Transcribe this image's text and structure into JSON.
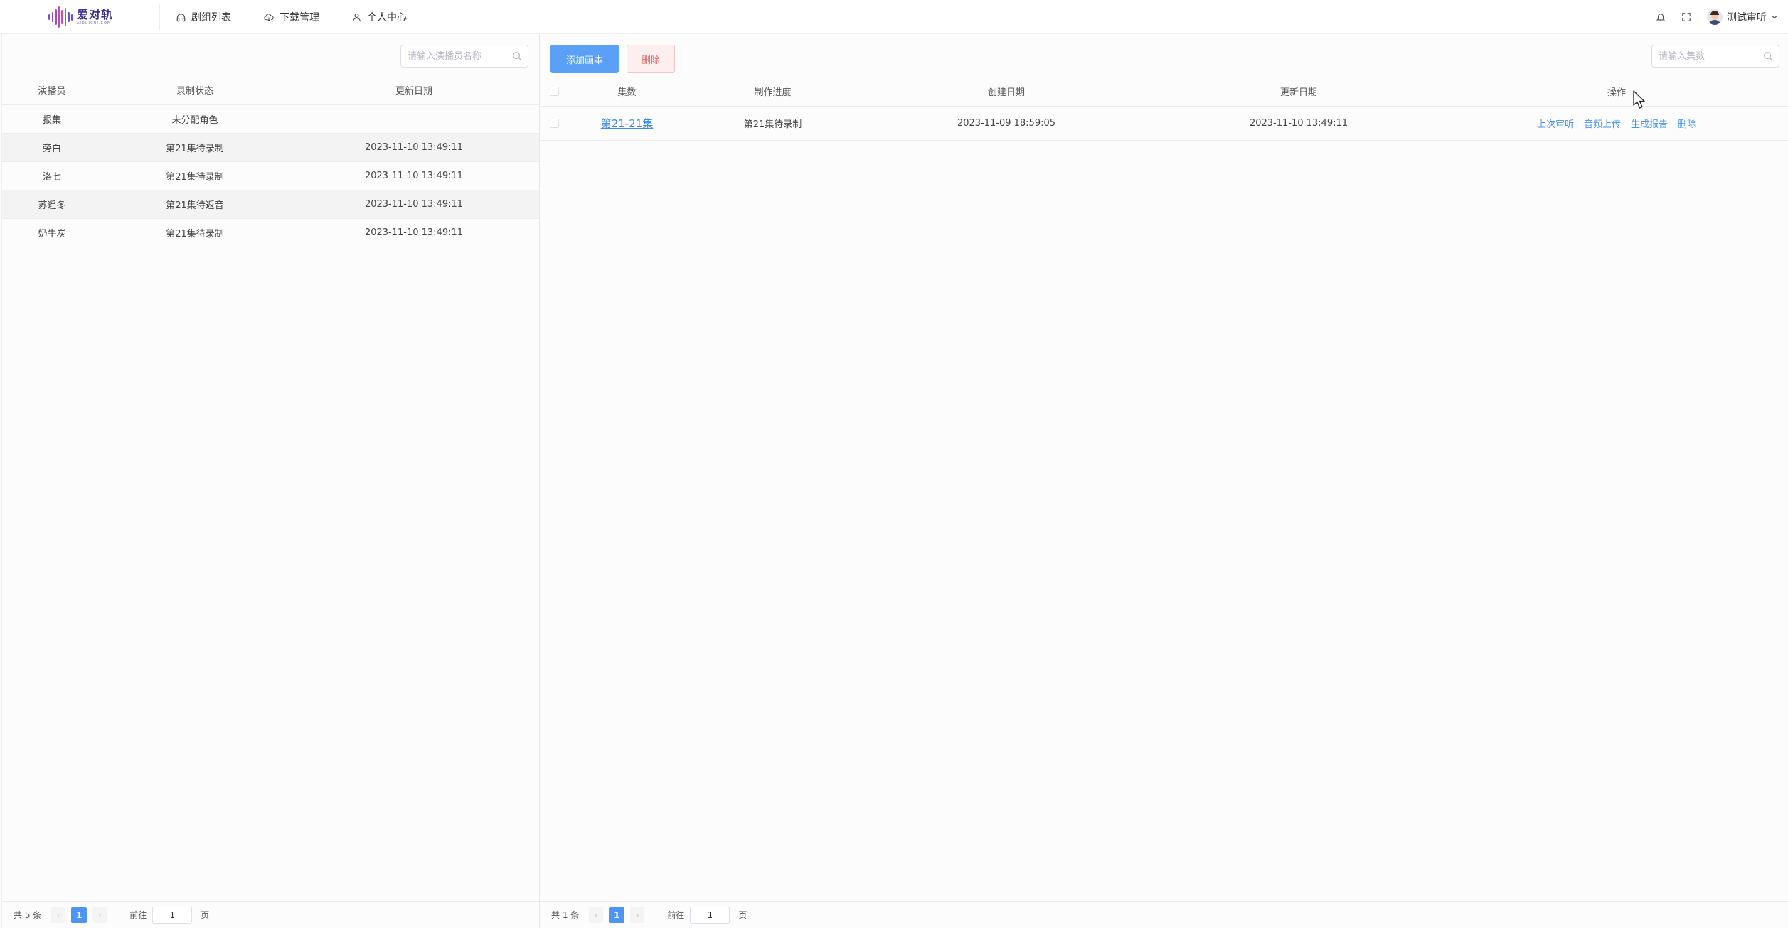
{
  "header": {
    "logo_name": "爱对轨",
    "logo_sub": "AIDUIGUI.COM",
    "nav": [
      {
        "label": "剧组列表",
        "icon": "headphones-icon"
      },
      {
        "label": "下载管理",
        "icon": "cloud-download-icon"
      },
      {
        "label": "个人中心",
        "icon": "user-icon"
      }
    ],
    "user_name": "测试审听"
  },
  "left_panel": {
    "search_placeholder": "请输入演播员名称",
    "columns": [
      "演播员",
      "录制状态",
      "更新日期"
    ],
    "rows": [
      {
        "name": "报集",
        "status": "未分配角色",
        "date": ""
      },
      {
        "name": "旁白",
        "status": "第21集待录制",
        "date": "2023-11-10 13:49:11"
      },
      {
        "name": "洛七",
        "status": "第21集待录制",
        "date": "2023-11-10 13:49:11"
      },
      {
        "name": "苏遥冬",
        "status": "第21集待返音",
        "date": "2023-11-10 13:49:11"
      },
      {
        "name": "奶牛炭",
        "status": "第21集待录制",
        "date": "2023-11-10 13:49:11"
      }
    ],
    "pager": {
      "total": "共 5 条",
      "page": "1",
      "goto_label": "前往",
      "goto_value": "1",
      "page_unit": "页"
    }
  },
  "right_panel": {
    "add_button": "添加画本",
    "delete_button": "删除",
    "search_placeholder": "请输入集数",
    "columns": [
      "集数",
      "制作进度",
      "创建日期",
      "更新日期",
      "操作"
    ],
    "rows": [
      {
        "episode": "第21-21集",
        "progress": "第21集待录制",
        "created": "2023-11-09 18:59:05",
        "updated": "2023-11-10 13:49:11",
        "actions": [
          "上次审听",
          "音频上传",
          "生成报告",
          "删除"
        ]
      }
    ],
    "pager": {
      "total": "共 1 条",
      "page": "1",
      "goto_label": "前往",
      "goto_value": "1",
      "page_unit": "页"
    }
  },
  "colors": {
    "primary": "#5aa0f7",
    "danger": "#e26b6b",
    "link": "#3d8be8"
  }
}
